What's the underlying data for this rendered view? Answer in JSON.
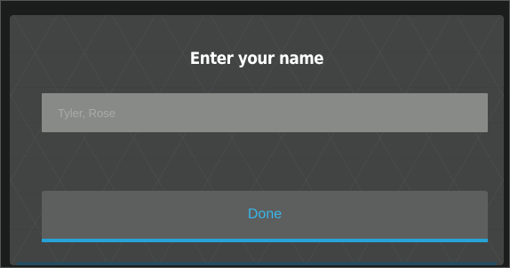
{
  "dialog": {
    "title": "Enter your name",
    "name_input": {
      "value": "",
      "placeholder": "Tyler, Rose"
    },
    "done_label": "Done"
  },
  "colors": {
    "dialog_background": "#424444",
    "input_background": "#888a88",
    "button_background": "#5d5f5f",
    "accent": "#27a3d6",
    "title_text": "#ffffff"
  }
}
